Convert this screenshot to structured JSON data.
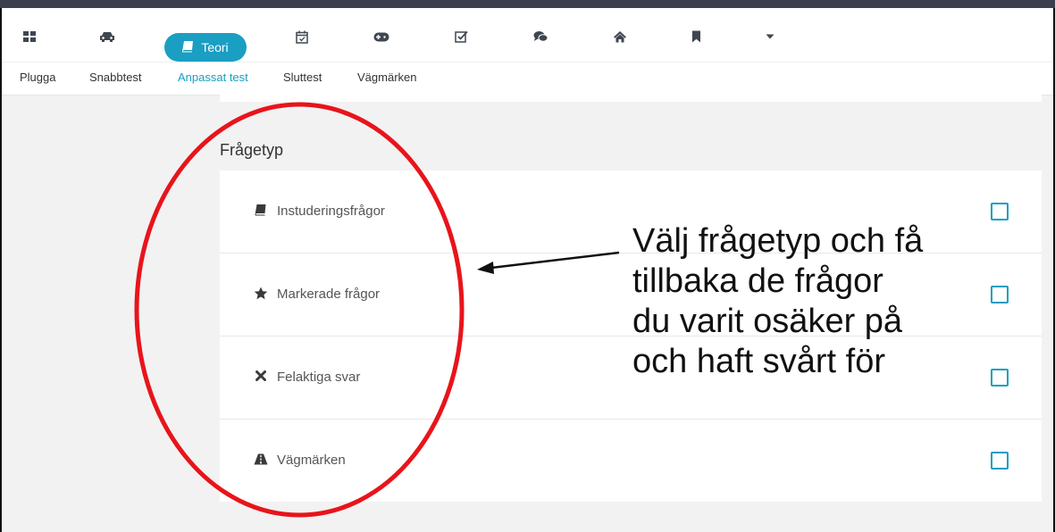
{
  "nav_icons": [
    {
      "name": "grid-icon"
    },
    {
      "name": "car-icon"
    },
    {
      "name": "calendar-icon"
    },
    {
      "name": "gamepad-icon"
    },
    {
      "name": "checkbox-icon"
    },
    {
      "name": "chat-icon"
    },
    {
      "name": "home-icon"
    },
    {
      "name": "bookmark-icon"
    },
    {
      "name": "caret-down-icon"
    }
  ],
  "active_nav": {
    "label": "Teori",
    "icon": "book-icon"
  },
  "tabs": [
    "Plugga",
    "Snabbtest",
    "Anpassat test",
    "Sluttest",
    "Vägmärken"
  ],
  "active_tab": "Anpassat test",
  "section_title": "Frågetyp",
  "items": [
    {
      "label": "Instuderingsfrågor",
      "icon": "book-icon",
      "checked": false
    },
    {
      "label": "Markerade frågor",
      "icon": "star-icon",
      "checked": false
    },
    {
      "label": "Felaktiga svar",
      "icon": "x-icon",
      "checked": false
    },
    {
      "label": "Vägmärken",
      "icon": "road-icon",
      "checked": false
    }
  ],
  "annotation": {
    "lines": [
      "Välj frågetyp och få",
      "tillbaka de frågor",
      "du varit osäker på",
      "och haft svårt för"
    ],
    "circle_color": "#e8141b"
  },
  "colors": {
    "accent": "#1a9ec2",
    "topbar": "#3a3f4b",
    "annotation": "#e8141b"
  }
}
